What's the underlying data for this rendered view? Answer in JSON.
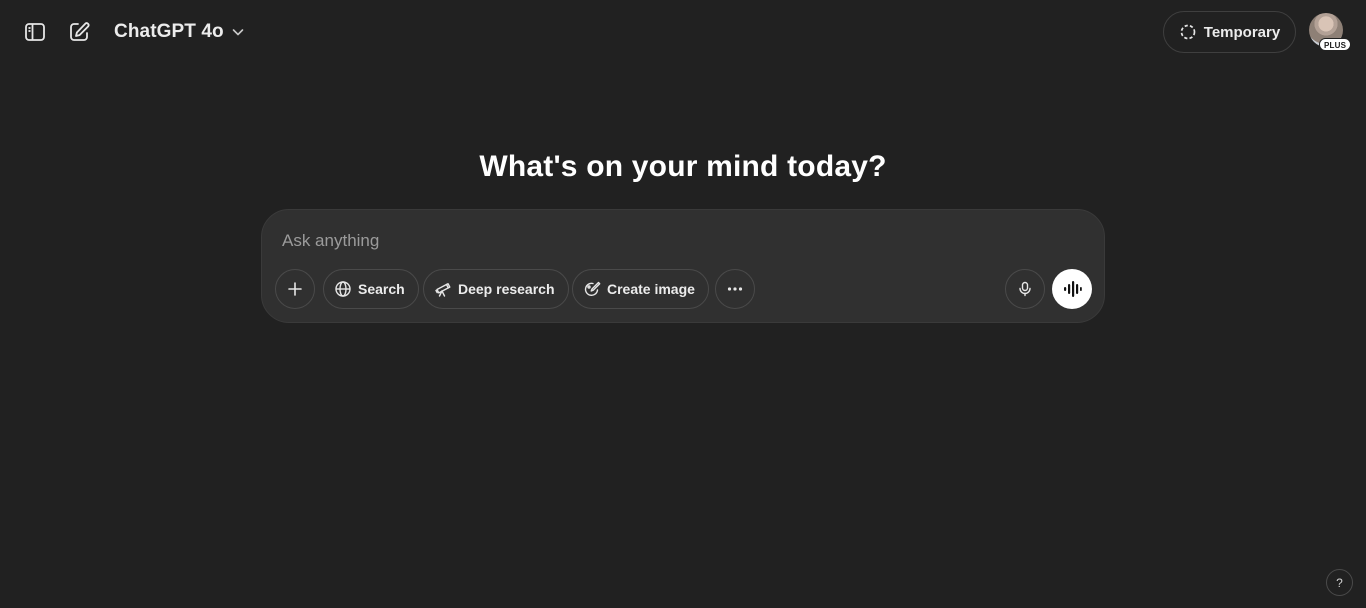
{
  "header": {
    "model_name": "ChatGPT 4o",
    "temporary_label": "Temporary",
    "plan_badge": "PLUS",
    "icons": {
      "sidebar_toggle": "sidebar-toggle-icon",
      "new_chat": "new-chat-icon",
      "model_dropdown": "chevron-down-icon",
      "temporary": "dashed-circle-icon"
    }
  },
  "main": {
    "headline": "What's on your mind today?",
    "composer": {
      "placeholder": "Ask anything",
      "value": "",
      "tools": [
        {
          "label": "Search",
          "icon": "globe-icon"
        },
        {
          "label": "Deep research",
          "icon": "telescope-icon"
        },
        {
          "label": "Create image",
          "icon": "image-brush-icon"
        }
      ]
    }
  },
  "footer": {
    "help_label": "?"
  },
  "colors": {
    "background": "#212121",
    "composer_background": "#303030",
    "border": "#4a4a4a",
    "text": "#ececec",
    "placeholder": "#9b9b9b",
    "voice_button": "#ffffff"
  }
}
